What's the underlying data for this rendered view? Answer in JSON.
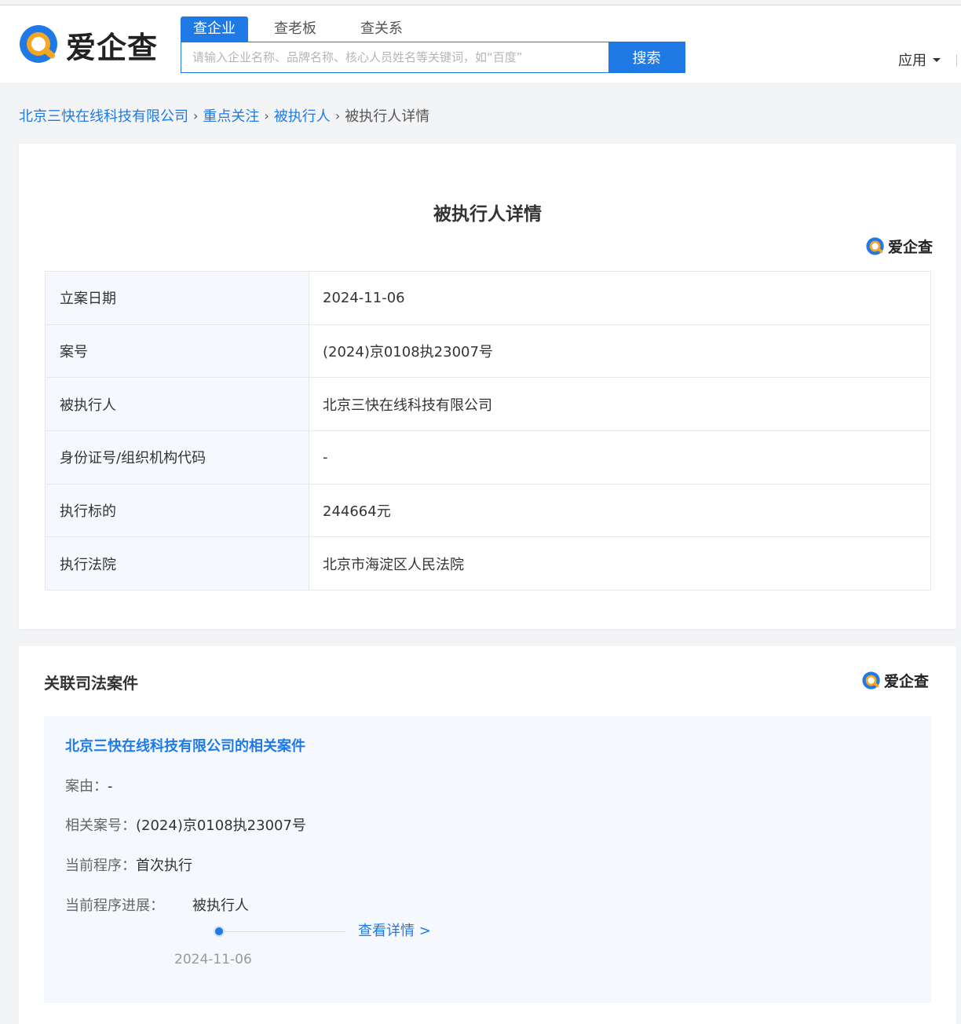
{
  "header": {
    "logo_text": "爱企查",
    "search_tabs": [
      {
        "label": "查企业",
        "active": true
      },
      {
        "label": "查老板",
        "active": false
      },
      {
        "label": "查关系",
        "active": false
      }
    ],
    "search_placeholder": "请输入企业名称、品牌名称、核心人员姓名等关键词，如“百度”",
    "search_value": "",
    "search_button": "搜索",
    "apps_label": "应用"
  },
  "breadcrumb": {
    "items": [
      "北京三快在线科技有限公司",
      "重点关注",
      "被执行人"
    ],
    "current": "被执行人详情"
  },
  "detail": {
    "title": "被执行人详情",
    "watermark": "爱企查",
    "rows": [
      {
        "label": "立案日期",
        "value": "2024-11-06"
      },
      {
        "label": "案号",
        "value": "(2024)京0108执23007号"
      },
      {
        "label": "被执行人",
        "value": "北京三快在线科技有限公司"
      },
      {
        "label": "身份证号/组织机构代码",
        "value": "-"
      },
      {
        "label": "执行标的",
        "value": "244664元"
      },
      {
        "label": "执行法院",
        "value": "北京市海淀区人民法院"
      }
    ]
  },
  "related": {
    "title": "关联司法案件",
    "watermark": "爱企查",
    "case": {
      "title": "北京三快在线科技有限公司的相关案件",
      "cause_label": "案由：",
      "cause_value": "-",
      "case_no_label": "相关案号：",
      "case_no_value": "(2024)京0108执23007号",
      "procedure_label": "当前程序：",
      "procedure_value": "首次执行",
      "progress_label": "当前程序进展：",
      "step_name": "被执行人",
      "step_date": "2024-11-06",
      "view_detail": "查看详情 >"
    }
  },
  "colors": {
    "accent": "#1f7ae6",
    "label_bg": "#f5f8fd",
    "logo_orange": "#f5a623"
  },
  "icons": {
    "logo": "aiqicha-q-logo-icon",
    "caret": "caret-down-icon",
    "breadcrumb_sep": "chevron-right-icon"
  }
}
